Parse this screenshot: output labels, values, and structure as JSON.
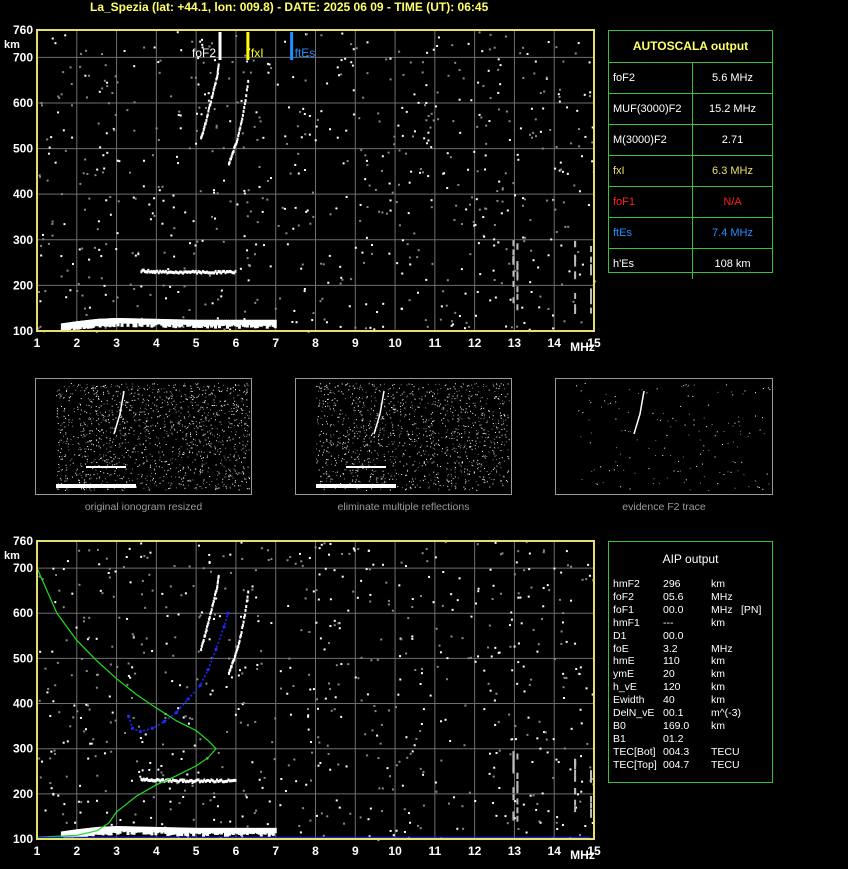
{
  "header": {
    "title": "La_Spezia (lat: +44.1, lon: 009.8) - DATE: 2025 06 09 - TIME (UT): 06:45"
  },
  "colors": {
    "frame": "#e6e06a",
    "grid": "#6e6e6e",
    "panel_border": "#39c239",
    "foF2": "#ffffff",
    "fxI": "#ffff00",
    "ftEs": "#1e90ff",
    "foF1": "#ff2020",
    "profile": "#22dd22",
    "trace": "#1c2cff"
  },
  "chart_data": [
    {
      "type": "scatter",
      "name_id": "main-ionogram",
      "xlabel": "MHz",
      "ylabel": "km",
      "xlim": [
        1,
        15
      ],
      "ylim": [
        100,
        760
      ],
      "xticks": [
        1,
        2,
        3,
        4,
        5,
        6,
        7,
        8,
        9,
        10,
        11,
        12,
        13,
        14,
        15
      ],
      "yticks": [
        100,
        200,
        300,
        400,
        500,
        600,
        700,
        760
      ],
      "grid": true,
      "markers": [
        {
          "label": "foF2",
          "x": 5.6,
          "color": "#ffffff"
        },
        {
          "label": "fxI",
          "x": 6.3,
          "color": "#ffff00"
        },
        {
          "label": "ftEs",
          "x": 7.4,
          "color": "#1e90ff"
        }
      ],
      "traces": {
        "F_o": [
          [
            5.1,
            525
          ],
          [
            5.2,
            555
          ],
          [
            5.3,
            590
          ],
          [
            5.4,
            625
          ],
          [
            5.5,
            660
          ],
          [
            5.55,
            690
          ]
        ],
        "F_x": [
          [
            5.8,
            470
          ],
          [
            5.9,
            495
          ],
          [
            6.0,
            520
          ],
          [
            6.1,
            555
          ],
          [
            6.2,
            600
          ],
          [
            6.3,
            660
          ]
        ],
        "Es": [
          [
            1.6,
            110
          ],
          [
            2.0,
            115
          ],
          [
            2.5,
            120
          ],
          [
            3.0,
            122
          ],
          [
            4.0,
            120
          ],
          [
            5.0,
            118
          ],
          [
            6.0,
            118
          ],
          [
            7.0,
            118
          ]
        ],
        "Es2": [
          [
            3.6,
            235
          ],
          [
            4.0,
            233
          ],
          [
            4.5,
            232
          ],
          [
            5.0,
            232
          ],
          [
            5.5,
            232
          ],
          [
            6.0,
            232
          ]
        ]
      }
    },
    {
      "type": "scatter",
      "name_id": "aip-ionogram",
      "xlabel": "MHz",
      "ylabel": "km",
      "xlim": [
        1,
        15
      ],
      "ylim": [
        100,
        760
      ],
      "xticks": [
        1,
        2,
        3,
        4,
        5,
        6,
        7,
        8,
        9,
        10,
        11,
        12,
        13,
        14,
        15
      ],
      "yticks": [
        100,
        200,
        300,
        400,
        500,
        600,
        700,
        760
      ],
      "grid": true,
      "traces": {
        "F_o": [
          [
            5.1,
            525
          ],
          [
            5.2,
            555
          ],
          [
            5.3,
            590
          ],
          [
            5.4,
            625
          ],
          [
            5.5,
            660
          ],
          [
            5.55,
            690
          ]
        ],
        "F_x": [
          [
            5.8,
            470
          ],
          [
            5.9,
            495
          ],
          [
            6.0,
            520
          ],
          [
            6.1,
            555
          ],
          [
            6.2,
            600
          ],
          [
            6.3,
            660
          ]
        ],
        "Es": [
          [
            1.6,
            110
          ],
          [
            2.0,
            115
          ],
          [
            2.5,
            120
          ],
          [
            3.0,
            122
          ],
          [
            4.0,
            120
          ],
          [
            5.0,
            118
          ],
          [
            6.0,
            118
          ],
          [
            7.0,
            118
          ]
        ],
        "Es2": [
          [
            3.6,
            235
          ],
          [
            4.0,
            233
          ],
          [
            4.5,
            232
          ],
          [
            5.0,
            232
          ],
          [
            5.5,
            232
          ],
          [
            6.0,
            232
          ]
        ]
      },
      "profile": [
        [
          1.0,
          700
        ],
        [
          1.5,
          600
        ],
        [
          2.0,
          540
        ],
        [
          2.5,
          495
        ],
        [
          3.0,
          455
        ],
        [
          3.5,
          420
        ],
        [
          4.0,
          390
        ],
        [
          4.5,
          362
        ],
        [
          5.0,
          340
        ],
        [
          5.3,
          318
        ],
        [
          5.5,
          300
        ],
        [
          5.3,
          280
        ],
        [
          5.0,
          262
        ],
        [
          4.5,
          240
        ],
        [
          4.0,
          220
        ],
        [
          3.5,
          195
        ],
        [
          3.0,
          160
        ],
        [
          2.8,
          135
        ],
        [
          2.5,
          118
        ],
        [
          2.0,
          108
        ],
        [
          1.0,
          104
        ]
      ],
      "fitted_trace": [
        [
          3.3,
          372
        ],
        [
          3.4,
          345
        ],
        [
          3.6,
          338
        ],
        [
          3.9,
          345
        ],
        [
          4.2,
          360
        ],
        [
          4.5,
          380
        ],
        [
          4.8,
          410
        ],
        [
          5.1,
          440
        ],
        [
          5.3,
          475
        ],
        [
          5.5,
          520
        ],
        [
          5.7,
          570
        ],
        [
          5.8,
          600
        ]
      ]
    }
  ],
  "autoscala": {
    "title": "AUTOSCALA output",
    "rows": [
      {
        "key": "foF2",
        "value": "5.6 MHz",
        "color": "#ffffff"
      },
      {
        "key": "MUF(3000)F2",
        "value": "15.2 MHz",
        "color": "#ffffff"
      },
      {
        "key": "M(3000)F2",
        "value": "2.71",
        "color": "#ffffff"
      },
      {
        "key": "fxI",
        "value": "6.3 MHz",
        "color": "#e6e06a"
      },
      {
        "key": "foF1",
        "value": "N/A",
        "color": "#ff2020"
      },
      {
        "key": "ftEs",
        "value": "7.4 MHz",
        "color": "#1e90ff"
      },
      {
        "key": "h'Es",
        "value": "108     km",
        "color": "#ffffff"
      }
    ]
  },
  "aip": {
    "title": "AIP output",
    "rows": [
      [
        "hmF2",
        "296",
        "km",
        ""
      ],
      [
        "foF2",
        "05.6",
        "MHz",
        ""
      ],
      [
        "foF1",
        "00.0",
        "MHz",
        "[PN]"
      ],
      [
        "hmF1",
        "---",
        "km",
        ""
      ],
      [
        "D1",
        "00.0",
        "",
        ""
      ],
      [
        "foE",
        "3.2",
        "MHz",
        ""
      ],
      [
        "hmE",
        "110",
        "km",
        ""
      ],
      [
        "ymE",
        "20",
        "km",
        ""
      ],
      [
        "h_vE",
        "120",
        "km",
        ""
      ],
      [
        "Ewidth",
        "40",
        "km",
        ""
      ],
      [
        "DelN_vE",
        "00.1",
        "m^(-3)",
        ""
      ],
      [
        "B0",
        "169.0",
        "km",
        ""
      ],
      [
        "B1",
        "01.2",
        "",
        ""
      ],
      [
        "TEC[Bot]",
        "004.3",
        "TECU",
        ""
      ],
      [
        "TEC[Top]",
        "004.7",
        "TECU",
        ""
      ]
    ]
  },
  "thumbnails": [
    {
      "caption": "original ionogram resized"
    },
    {
      "caption": "eliminate multiple reflections"
    },
    {
      "caption": "evidence F2 trace"
    }
  ]
}
